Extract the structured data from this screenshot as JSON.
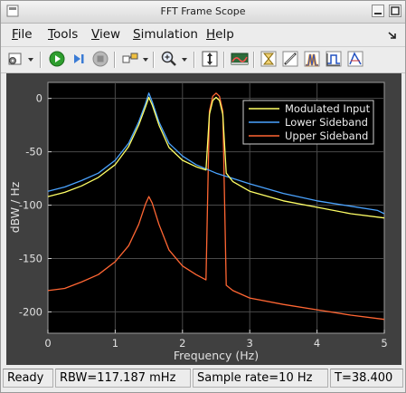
{
  "window": {
    "title": "FFT Frame Scope"
  },
  "menu": {
    "items": [
      {
        "label": "File",
        "key": "F",
        "rest": "ile"
      },
      {
        "label": "Tools",
        "key": "T",
        "rest": "ools"
      },
      {
        "label": "View",
        "key": "V",
        "rest": "iew"
      },
      {
        "label": "Simulation",
        "key": "S",
        "rest": "imulation"
      },
      {
        "label": "Help",
        "key": "H",
        "rest": "elp"
      }
    ]
  },
  "toolbar": {
    "icons": [
      "configuration-icon",
      "run-icon",
      "step-forward-icon",
      "stop-icon",
      "highlight-block-icon",
      "zoom-in-icon",
      "autoscale-icon",
      "restore-view-icon",
      "triggers-icon",
      "cursor-measurements-icon",
      "peak-finder-icon",
      "bilevel-measurements-icon",
      "signal-statistics-icon"
    ]
  },
  "colors": {
    "plot_bg": "#000000",
    "frame_bg": "#404040",
    "axis_text": "#e0e0e0",
    "grid": "#4a4a4a",
    "modulated": "#ffff66",
    "lower": "#4aa3ff",
    "upper": "#ff6633"
  },
  "chart_data": {
    "type": "line",
    "xlabel": "Frequency (Hz)",
    "ylabel": "dBW / Hz",
    "xlim": [
      0,
      5
    ],
    "ylim": [
      -220,
      15
    ],
    "xticks": [
      "0",
      "1",
      "2",
      "3",
      "4",
      "5"
    ],
    "yticks": [
      "0",
      "-50",
      "-100",
      "-150",
      "-200"
    ],
    "grid": true,
    "legend_position": "top-right",
    "series": [
      {
        "name": "Modulated Input",
        "color": "#ffff66",
        "x": [
          0,
          0.25,
          0.5,
          0.75,
          1.0,
          1.2,
          1.35,
          1.45,
          1.5,
          1.55,
          1.65,
          1.8,
          2.0,
          2.2,
          2.35,
          2.4,
          2.45,
          2.5,
          2.55,
          2.6,
          2.65,
          2.75,
          3.0,
          3.5,
          4.0,
          4.5,
          5.0
        ],
        "y": [
          -92,
          -88,
          -82,
          -74,
          -62,
          -45,
          -25,
          -8,
          1,
          -6,
          -25,
          -46,
          -58,
          -64,
          -67,
          -15,
          -2,
          1,
          -2,
          -15,
          -70,
          -78,
          -87,
          -96,
          -102,
          -108,
          -112
        ]
      },
      {
        "name": "Lower Sideband",
        "color": "#4aa3ff",
        "x": [
          0,
          0.25,
          0.5,
          0.75,
          1.0,
          1.2,
          1.35,
          1.45,
          1.5,
          1.55,
          1.65,
          1.8,
          2.0,
          2.2,
          2.5,
          3.0,
          3.5,
          4.0,
          4.5,
          4.9,
          5.0
        ],
        "y": [
          -87,
          -83,
          -77,
          -70,
          -58,
          -42,
          -22,
          -5,
          5,
          -3,
          -22,
          -42,
          -54,
          -62,
          -70,
          -80,
          -89,
          -96,
          -101,
          -105,
          -108
        ]
      },
      {
        "name": "Upper Sideband",
        "color": "#ff6633",
        "x": [
          0,
          0.25,
          0.5,
          0.75,
          1.0,
          1.2,
          1.35,
          1.45,
          1.5,
          1.55,
          1.65,
          1.8,
          2.0,
          2.2,
          2.35,
          2.4,
          2.45,
          2.5,
          2.55,
          2.6,
          2.65,
          2.75,
          3.0,
          3.5,
          4.0,
          4.5,
          5.0
        ],
        "y": [
          -180,
          -178,
          -172,
          -165,
          -153,
          -138,
          -118,
          -99,
          -92,
          -98,
          -118,
          -142,
          -157,
          -165,
          -170,
          -12,
          2,
          5,
          2,
          -12,
          -175,
          -180,
          -187,
          -193,
          -198,
          -203,
          -207
        ]
      }
    ]
  },
  "status": {
    "ready": "Ready",
    "rbw": "RBW=117.187 mHz",
    "sample_rate": "Sample rate=10 Hz",
    "time": "T=38.400"
  }
}
